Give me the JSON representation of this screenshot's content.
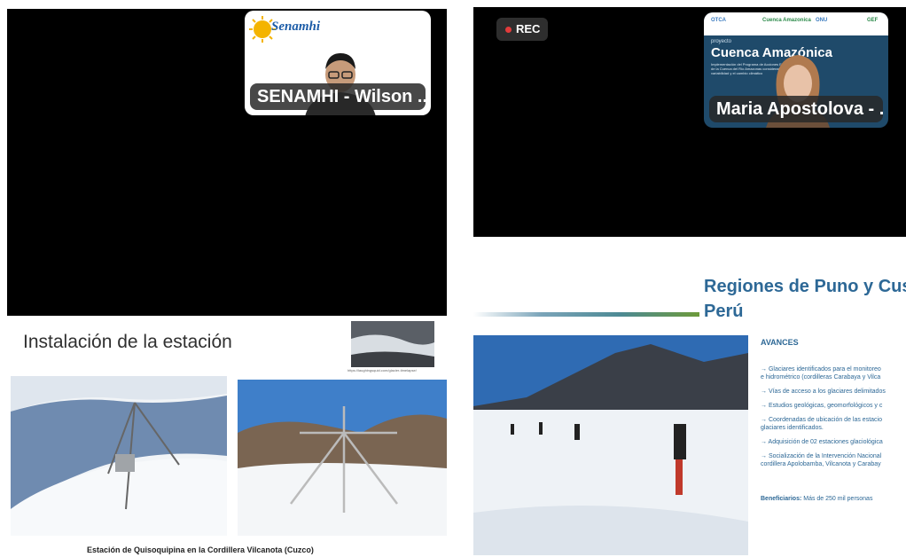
{
  "meeting": {
    "participants": [
      {
        "name": "SENAMHI - Wilson ...",
        "logo_text": "Senamhi"
      },
      {
        "name": "Maria Apostolova - ..."
      }
    ],
    "rec_label": "REC"
  },
  "maria_background": {
    "header_logos": [
      "OTCA",
      "Cuenca Amazonica",
      "ONU",
      "GEF"
    ],
    "proyecto_label": "proyecto",
    "title": "Cuenca Amazónica",
    "subtitle": "Implementación del Programa de Acciones Estratégicas de la Cuenca del Río Amazonas considerando la variabilidad y el cambio climático"
  },
  "slide_left": {
    "title": "Instalación de la estación",
    "thumb_caption": "https://laughingsquid.com/glacier-timelapse/",
    "caption": "Estación de Quisoquipina en la Cordillera Vilcanota (Cuzco)"
  },
  "slide_right": {
    "title_line1": "Regiones de Puno y Cusco,",
    "title_line2": "Perú",
    "avances_title": "AVANCES",
    "avances": [
      "→ Glaciares identificados para el monitoreo",
      "e hidrométrico (cordilleras Carabaya y Vilca",
      "→ Vías de acceso a los glaciares delimitados",
      "→ Estudios geológicas, geomorfológicos y c",
      "→ Coordenadas de ubicación de las estacio",
      "glaciares identificados.",
      "→ Adquisición de 02 estaciones glaciológica",
      "→ Socialización de la Intervención Nacional",
      "cordillera Apolobamba, Vilcanota y Carabay"
    ],
    "beneficiarios_label": "Beneficiarios:",
    "beneficiarios_value": " Más de 250 mil personas"
  },
  "colors": {
    "slide_blue": "#2d6896",
    "rec_red": "#e23b3b",
    "badge_bg": "#2b2b2b"
  },
  "icons": [
    "senamhi-sun-logo",
    "rec-dot-icon"
  ]
}
